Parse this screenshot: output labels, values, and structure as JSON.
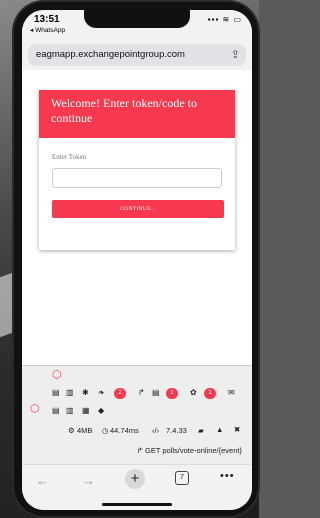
{
  "status": {
    "time": "13:51",
    "back_app": "◂ WhatsApp",
    "icons": "▪▪▪ ≋ ▭"
  },
  "browser": {
    "url": "eagmapp.exchangepointgroup.com",
    "share_icon": "share-icon",
    "tab_count": "7"
  },
  "card": {
    "title": "Welcome! Enter token/code to continue",
    "token_label": "Enter Token",
    "token_value": "",
    "continue_label": "CONTINUE..."
  },
  "debugbar": {
    "badges": [
      "2",
      "1",
      "1"
    ],
    "memory": "4MB",
    "duration": "44.74ms",
    "version": "7.4.33",
    "route": "GET polls/vote-online/{event}"
  },
  "colors": {
    "accent": "#f6394e"
  }
}
